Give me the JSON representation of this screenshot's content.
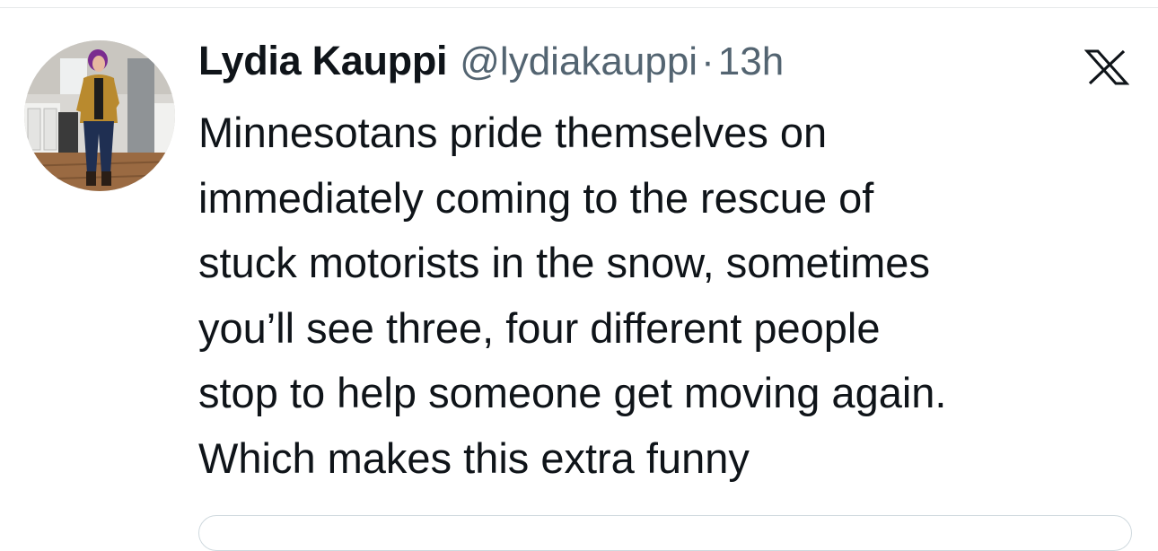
{
  "tweet": {
    "author": {
      "display_name": "Lydia Kauppi",
      "handle": "@lydiakauppi",
      "avatar_icon": "profile-photo"
    },
    "separator": "·",
    "timestamp": "13h",
    "platform_icon": "x-logo-icon",
    "text_lines": [
      "Minnesotans pride themselves on",
      "immediately coming to the rescue of",
      "stuck motorists in the snow, sometimes",
      "you’ll see three, four different people",
      "stop to help someone get moving again.",
      "Which makes this extra funny"
    ]
  },
  "colors": {
    "primary_text": "#0f1419",
    "secondary_text": "#536471",
    "border": "#cfd9de",
    "background": "#ffffff"
  }
}
